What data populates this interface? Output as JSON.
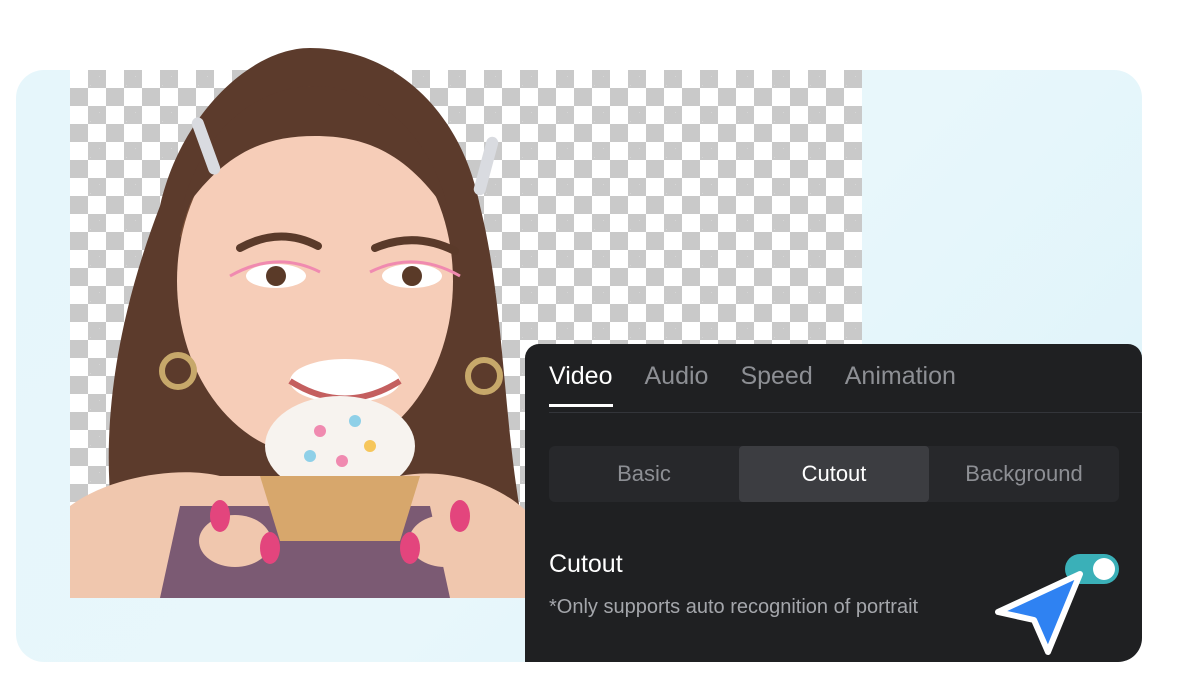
{
  "colors": {
    "card_bg": "#e6f6fb",
    "panel_bg": "#1f2022",
    "toggle_on": "#3ab0b8",
    "cursor_fill": "#2f82f2"
  },
  "editor_panel": {
    "tabs": [
      {
        "label": "Video",
        "active": true
      },
      {
        "label": "Audio",
        "active": false
      },
      {
        "label": "Speed",
        "active": false
      },
      {
        "label": "Animation",
        "active": false
      }
    ],
    "segments": [
      {
        "label": "Basic",
        "active": false
      },
      {
        "label": "Cutout",
        "active": true
      },
      {
        "label": "Background",
        "active": false
      }
    ],
    "option": {
      "title": "Cutout",
      "note": "*Only supports auto recognition of portrait",
      "toggle_on": true
    }
  },
  "icons": {
    "pointer": "cursor-arrow-icon"
  }
}
